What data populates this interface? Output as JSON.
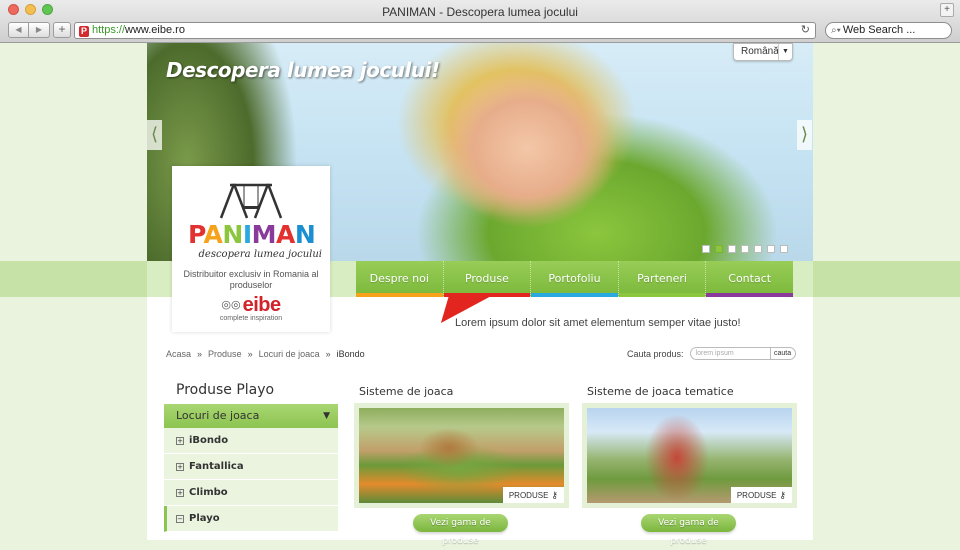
{
  "browser": {
    "title": "PANIMAN - Descopera lumea jocului",
    "url_https": "https://",
    "url_rest": "www.eibe.ro",
    "search_placeholder": "Web Search ..."
  },
  "hero": {
    "headline": "Descopera lumea jocului!",
    "language": "Română",
    "slide_count": 7,
    "active_slide": 2
  },
  "brand": {
    "name_letters": [
      "P",
      "A",
      "N",
      "I",
      "M",
      "A",
      "N"
    ],
    "tagline": "descopera lumea jocului",
    "distributor": "Distribuitor exclusiv in Romania al produselor",
    "partner": "eibe",
    "partner_sub": "complete inspiration"
  },
  "nav": {
    "items": [
      {
        "label": "Despre noi",
        "color": "#f6a21b"
      },
      {
        "label": "Produse",
        "color": "#e2261f"
      },
      {
        "label": "Portofoliu",
        "color": "#29a9e0"
      },
      {
        "label": "Parteneri",
        "color": "#8cc63e"
      },
      {
        "label": "Contact",
        "color": "#8a3a9a"
      }
    ],
    "tagline": "Lorem ipsum dolor sit amet elementum semper vitae justo!"
  },
  "breadcrumb": {
    "items": [
      "Acasa",
      "Produse",
      "Locuri de joaca",
      "iBondo"
    ]
  },
  "product_search": {
    "label": "Cauta produs:",
    "placeholder": "lorem ipsum elementum",
    "button": "cauta"
  },
  "sidebar": {
    "title": "Produse Playo",
    "section": "Locuri de joaca",
    "items": [
      {
        "label": "iBondo",
        "expanded": false
      },
      {
        "label": "Fantallica",
        "expanded": false
      },
      {
        "label": "Climbo",
        "expanded": false
      },
      {
        "label": "Playo",
        "expanded": true
      }
    ]
  },
  "cards": [
    {
      "title": "Sisteme de joaca",
      "tag": "PRODUSE",
      "button": "Vezi gama de produse"
    },
    {
      "title": "Sisteme de joaca tematice",
      "tag": "PRODUSE",
      "button": "Vezi gama de produse"
    }
  ]
}
